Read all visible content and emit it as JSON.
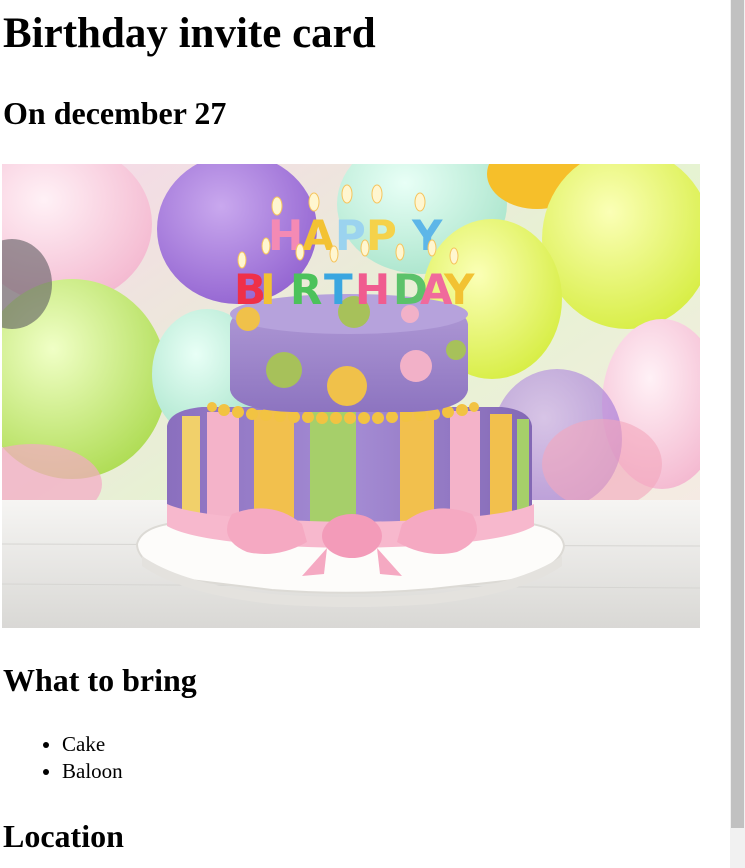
{
  "invite": {
    "title": "Birthday invite card",
    "date_heading": "On december 27",
    "image": {
      "icon": "birthday-cake-photo",
      "candle_text": "HAPPY BIRTHDAY",
      "colors": {
        "sky": "#f6e9f2",
        "cake_top": "#9b86c9",
        "ribbon": "#f5b8cc",
        "table": "#ecebe8"
      }
    },
    "bring_heading": "What to bring",
    "bring_items": [
      "Cake",
      "Baloon"
    ],
    "location_heading": "Location"
  }
}
